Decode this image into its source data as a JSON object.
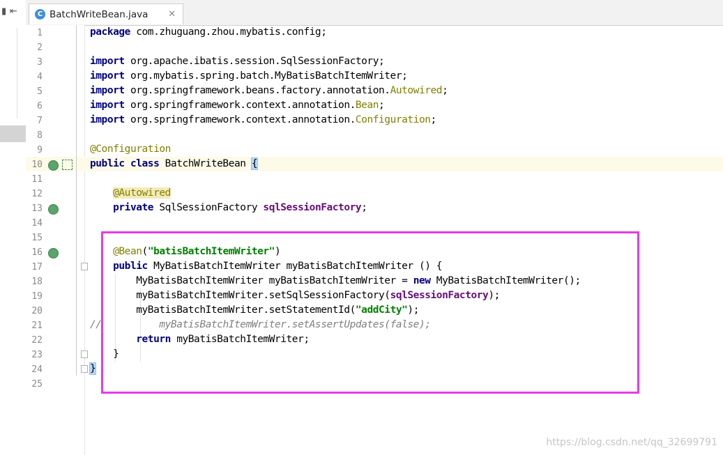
{
  "left_panel": {
    "restore_icon": "restore-icon",
    "collapse_icon": "collapse-left-icon"
  },
  "tab": {
    "icon_letter": "C",
    "title": "BatchWriteBean.java",
    "close": "✕"
  },
  "lines": [
    {
      "n": "1"
    },
    {
      "n": "2"
    },
    {
      "n": "3"
    },
    {
      "n": "4"
    },
    {
      "n": "5"
    },
    {
      "n": "6"
    },
    {
      "n": "7"
    },
    {
      "n": "8"
    },
    {
      "n": "9"
    },
    {
      "n": "10"
    },
    {
      "n": "11"
    },
    {
      "n": "12"
    },
    {
      "n": "13"
    },
    {
      "n": "14"
    },
    {
      "n": "15"
    },
    {
      "n": "16"
    },
    {
      "n": "17"
    },
    {
      "n": "18"
    },
    {
      "n": "19"
    },
    {
      "n": "20"
    },
    {
      "n": "21"
    },
    {
      "n": "22"
    },
    {
      "n": "23"
    },
    {
      "n": "24"
    },
    {
      "n": "25"
    }
  ],
  "code": {
    "l1_kw": "package",
    "l1_rest": " com.zhuguang.zhou.mybatis.config;",
    "l3_kw": "import",
    "l3_rest": " org.apache.ibatis.session.SqlSessionFactory;",
    "l4_kw": "import",
    "l4_rest": " org.mybatis.spring.batch.MyBatisBatchItemWriter;",
    "l5_kw": "import",
    "l5_rest": " org.springframework.beans.factory.annotation.",
    "l5_ann": "Autowired",
    "l5_end": ";",
    "l6_kw": "import",
    "l6_rest": " org.springframework.context.annotation.",
    "l6_ann": "Bean",
    "l6_end": ";",
    "l7_kw": "import",
    "l7_rest": " org.springframework.context.annotation.",
    "l7_ann": "Configuration",
    "l7_end": ";",
    "l9_ann": "@Configuration",
    "l10_kw": "public class",
    "l10_rest": " BatchWriteBean ",
    "l10_brace": "{",
    "l12_ann": "@Autowired",
    "l13_kw": "private",
    "l13_rest": " SqlSessionFactory ",
    "l13_fld": "sqlSessionFactory",
    "l13_end": ";",
    "l16_ann": "@Bean",
    "l16_open": "(",
    "l16_str": "\"batisBatchItemWriter\"",
    "l16_close": ")",
    "l17_kw": "public",
    "l17_rest": " MyBatisBatchItemWriter myBatisBatchItemWriter () {",
    "l18_rest": "MyBatisBatchItemWriter myBatisBatchItemWriter = ",
    "l18_kw": "new",
    "l18_end": " MyBatisBatchItemWriter();",
    "l19_rest": "myBatisBatchItemWriter.setSqlSessionFactory(",
    "l19_fld": "sqlSessionFactory",
    "l19_end": ");",
    "l20_rest": "myBatisBatchItemWriter.setStatementId(",
    "l20_str": "\"addCity\"",
    "l20_end": ");",
    "l21_cmt": "//",
    "l21_rest": "myBatisBatchItemWriter.setAssertUpdates(false);",
    "l22_kw": "return",
    "l22_rest": " myBatisBatchItemWriter;",
    "l23_rest": "}",
    "l24_brace": "}"
  },
  "gutter_icons": {
    "l10": "bean-class-icon",
    "l13": "autowired-bean-icon",
    "l16": "bean-method-icon"
  },
  "watermark": "https://blog.csdn.net/qq_32699791",
  "colors": {
    "keyword": "#000080",
    "annotation": "#808000",
    "string": "#008000",
    "field": "#660e7a",
    "comment": "#808080",
    "highlight_box": "#e63ae6"
  }
}
